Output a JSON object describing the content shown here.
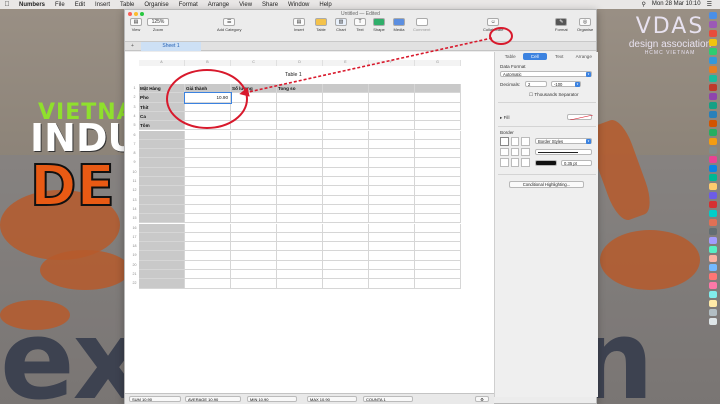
{
  "menubar": {
    "app": "Numbers",
    "items": [
      "File",
      "Edit",
      "Insert",
      "Table",
      "Organise",
      "Format",
      "Arrange",
      "View",
      "Share",
      "Window",
      "Help"
    ],
    "clock": "Mon 28 Mar  10:10"
  },
  "poster": {
    "line1": "VIETNAM",
    "line2": "INDU",
    "line3": "DE",
    "line4": "ex",
    "line5": "on"
  },
  "brand": {
    "name": "VDAS",
    "subtitle": "design association",
    "location": "HCMC VIETNAM"
  },
  "window": {
    "title": "Untitled — Edited"
  },
  "toolbar": {
    "view_label": "View",
    "zoom_label": "Zoom",
    "zoom_value": "125%",
    "add_category_label": "Add Category",
    "insert_label": "Insert",
    "table_label": "Table",
    "chart_label": "Chart",
    "text_label": "Text",
    "shape_label": "Shape",
    "media_label": "Media",
    "comment_label": "Comment",
    "collaborate_label": "Collaborate",
    "format_label": "Format",
    "organise_label": "Organise"
  },
  "sheets": {
    "add": "+",
    "tabs": [
      "Sheet 1"
    ]
  },
  "table": {
    "title": "Table 1",
    "columns": [
      "A",
      "B",
      "C",
      "D",
      "E",
      "F",
      "G"
    ],
    "headers": [
      "Mặt Hàng",
      "Giá thành",
      "Số lượng",
      "Tong so",
      "",
      "",
      ""
    ],
    "rows": [
      [
        "Pho",
        "10.90",
        "",
        "",
        "",
        "",
        ""
      ],
      [
        "Thit",
        "",
        "",
        "",
        "",
        "",
        ""
      ],
      [
        "Ca",
        "",
        "",
        "",
        "",
        "",
        ""
      ],
      [
        "Tôm",
        "",
        "",
        "",
        "",
        "",
        ""
      ]
    ],
    "row_numbers": [
      "1",
      "2",
      "3",
      "4",
      "5",
      "6",
      "7",
      "8",
      "9",
      "10",
      "11",
      "12",
      "13",
      "14",
      "15",
      "16",
      "17",
      "18",
      "19",
      "20",
      "21",
      "22"
    ]
  },
  "statusbar": {
    "sum": "SUM   10.90",
    "average": "AVERAGE   10.90",
    "min": "MIN   10.90",
    "max": "MAX   10.90",
    "counta": "COUNTA   1"
  },
  "inspector": {
    "tabs": [
      "Table",
      "Cell",
      "Text",
      "Arrange"
    ],
    "data_format_label": "Data Format",
    "data_format_value": "Automatic",
    "decimals_label": "Decimals:",
    "decimals_value": "2",
    "negative_value": "-100",
    "thousands_label": "Thousands Separator",
    "fill_label": "Fill",
    "border_label": "Border",
    "border_styles": "Border Styles",
    "border_width": "0.35 pt",
    "conditional_btn": "Conditional Highlighting..."
  },
  "colors": {
    "accent": "#3b82e0",
    "annotation": "#d8192c",
    "header_fill": "#c9c9c9"
  }
}
